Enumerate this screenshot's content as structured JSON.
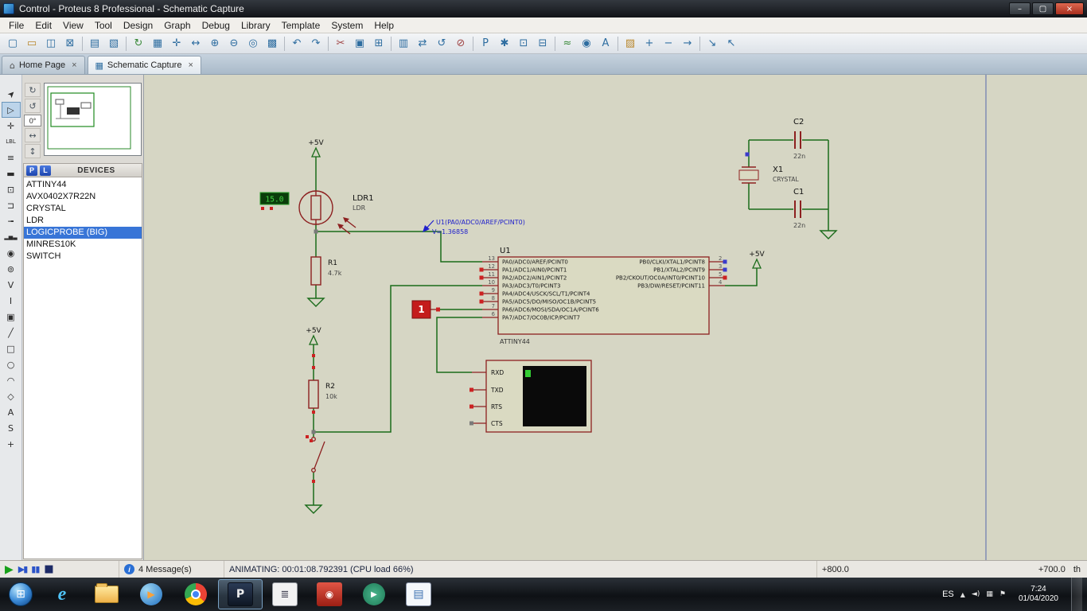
{
  "window": {
    "title": "Control - Proteus 8 Professional - Schematic Capture",
    "controls": {
      "minimize": "–",
      "maximize": "▢",
      "close": "×"
    }
  },
  "menu": {
    "items": [
      "File",
      "Edit",
      "View",
      "Tool",
      "Design",
      "Graph",
      "Debug",
      "Library",
      "Template",
      "System",
      "Help"
    ]
  },
  "toolbar": {
    "icons": {
      "new_project": "▢",
      "open_project": "▭",
      "save_project": "◫",
      "close_project": "⊠",
      "print": "▤",
      "mark_output_area": "▧",
      "redraw": "↻",
      "toggle_grid": "▦",
      "toggle_origin": "✛",
      "pan": "↔",
      "zoom_in": "⊕",
      "zoom_out": "⊖",
      "zoom_all": "◎",
      "zoom_area": "▩",
      "undo": "↶",
      "redo": "↷",
      "cut": "✂",
      "copy": "▣",
      "paste": "⊞",
      "copy_block": "▥",
      "move_block": "⇄",
      "rotate_block": "↺",
      "delete_block": "⊘",
      "pick_parts": "P",
      "make_device": "✱",
      "packaging_tool": "⊡",
      "decompose": "⊟",
      "wire_autorouter": "≈",
      "search_tag": "◉",
      "property_assignment": "A",
      "design_explorer": "▨",
      "new_sheet": "+",
      "remove_sheet": "−",
      "goto_sheet": "→",
      "zoom_to_child": "↘",
      "exit_to_parent": "↖"
    }
  },
  "tabs": {
    "home": {
      "icon": "⌂",
      "label": "Home Page",
      "close": "×"
    },
    "schematic": {
      "icon": "▦",
      "label": "Schematic Capture",
      "close": "×"
    }
  },
  "side_toolbar": {
    "selection": "➤",
    "component": "▷",
    "junction": "✛",
    "wire_label": "LBL",
    "text_script": "≡",
    "bus": "▬",
    "subcircuit": "⊡",
    "terminal": "⊐",
    "device_pin": "╼",
    "graph": "▂▅▃",
    "tape": "◉",
    "generator": "⊚",
    "voltage_probe": "V",
    "current_probe": "I",
    "instruments": "▣",
    "line2d": "╱",
    "box2d": "□",
    "circle2d": "○",
    "arc2d": "◠",
    "path2d": "◇",
    "text2d": "A",
    "symbol2d": "S",
    "marker2d": "+"
  },
  "orientation": {
    "rotate_cw": "↻",
    "rotate_ccw": "↺",
    "angle": "0°",
    "mirror_h": "↔",
    "mirror_v": "↕"
  },
  "devices_panel": {
    "pick_button": "P",
    "library_button": "L",
    "title": "DEVICES",
    "items": [
      "ATTINY44",
      "AVX0402X7R22N",
      "CRYSTAL",
      "LDR",
      "LOGICPROBE (BIG)",
      "MINRES10K",
      "SWITCH"
    ]
  },
  "schematic": {
    "power": {
      "vcc": "+5V"
    },
    "ldr": {
      "ref": "LDR1",
      "value": "LDR"
    },
    "r1": {
      "ref": "R1",
      "value": "4.7k"
    },
    "r2": {
      "ref": "R2",
      "value": "10k"
    },
    "c1": {
      "ref": "C1",
      "value": "22n"
    },
    "c2": {
      "ref": "C2",
      "value": "22n"
    },
    "x1": {
      "ref": "X1",
      "value": "CRYSTAL"
    },
    "display_value": "15.0",
    "logic_probe_value": "1",
    "voltage_probe": {
      "net": "U1(PA0/ADC0/AREF/PCINT0)",
      "value": "V=1.36858"
    },
    "terminal": {
      "pins": [
        "RXD",
        "TXD",
        "RTS",
        "CTS"
      ]
    },
    "u1": {
      "ref": "U1",
      "part": "ATTINY44",
      "left_pins": [
        {
          "num": "13",
          "name": "PA0/ADC0/AREF/PCINT0"
        },
        {
          "num": "12",
          "name": "PA1/ADC1/AIN0/PCINT1"
        },
        {
          "num": "11",
          "name": "PA2/ADC2/AIN1/PCINT2"
        },
        {
          "num": "10",
          "name": "PA3/ADC3/T0/PCINT3"
        },
        {
          "num": "9",
          "name": "PA4/ADC4/USCK/SCL/T1/PCINT4"
        },
        {
          "num": "8",
          "name": "PA5/ADC5/DO/MISO/OC1B/PCINT5"
        },
        {
          "num": "7",
          "name": "PA6/ADC6/MOSI/SDA/OC1A/PCINT6"
        },
        {
          "num": "6",
          "name": "PA7/ADC7/OC0B/ICP/PCINT7"
        }
      ],
      "right_pins": [
        {
          "num": "2",
          "name": "PB0/CLKI/XTAL1/PCINT8"
        },
        {
          "num": "3",
          "name": "PB1/XTAL2/PCINT9"
        },
        {
          "num": "5",
          "name": "PB2/CKOUT/OC0A/INT0/PCINT10"
        },
        {
          "num": "4",
          "name": "PB3/DW/RESET/PCINT11"
        }
      ]
    }
  },
  "status_bar": {
    "play": "▶",
    "step": "▶▮",
    "pause": "▮▮",
    "stop": "■",
    "info_icon": "i",
    "messages": "4 Message(s)",
    "animating": "ANIMATING: 00:01:08.792391 (CPU load 66%)",
    "coord_x": "+800.0",
    "coord_y": "+700.0",
    "units": "th"
  },
  "taskbar": {
    "start": "⊞",
    "apps": {
      "ie": "e",
      "wmp": "▶",
      "proteus": "P",
      "viewer": "≣",
      "player": "◉",
      "camtasia": "▶",
      "journal": "▤"
    },
    "language": "ES",
    "tray": {
      "expand": "▲",
      "volume": "◄)",
      "display": "▦",
      "flag": "⚑"
    },
    "clock": {
      "time": "7:24",
      "date": "01/04/2020"
    }
  }
}
